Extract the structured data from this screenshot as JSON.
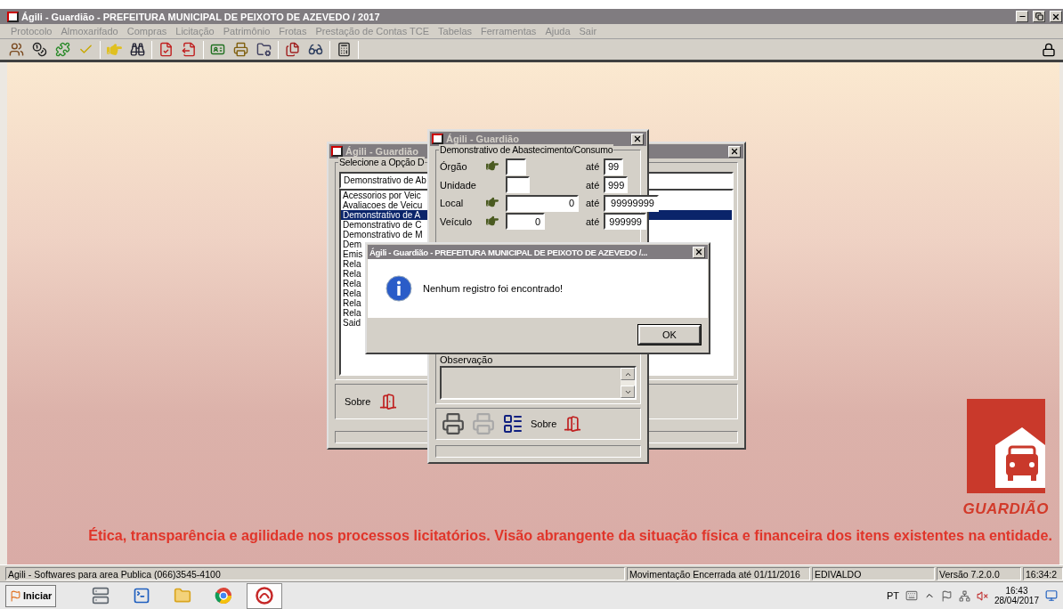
{
  "window": {
    "title": "Ágili - Guardião - PREFEITURA MUNICIPAL DE PEIXOTO DE AZEVEDO / 2017"
  },
  "menu": [
    "Protocolo",
    "Almoxarifado",
    "Compras",
    "Licitação",
    "Patrimônio",
    "Frotas",
    "Prestação de Contas TCE",
    "Tabelas",
    "Ferramentas",
    "Ajuda",
    "Sair"
  ],
  "selection_window": {
    "title": "Ágili - Guardião",
    "group_label": "Selecione a Opção D",
    "search_value": "Demonstrativo de Ab",
    "items": [
      {
        "label": "Acessorios por Veic",
        "selected": false
      },
      {
        "label": "Avaliacoes de Veicu",
        "selected": false
      },
      {
        "label": "Demonstrativo de A",
        "selected": true
      },
      {
        "label": "Demonstrativo de C",
        "selected": false
      },
      {
        "label": "Demonstrativo de M",
        "selected": false
      },
      {
        "label": "Dem",
        "selected": false
      },
      {
        "label": "Emis",
        "selected": false
      },
      {
        "label": "Rela",
        "selected": false
      },
      {
        "label": "Rela",
        "selected": false
      },
      {
        "label": "Rela",
        "selected": false
      },
      {
        "label": "Rela",
        "selected": false
      },
      {
        "label": "Rela",
        "selected": false
      },
      {
        "label": "Rela",
        "selected": false
      },
      {
        "label": "Said",
        "selected": false
      }
    ],
    "about_label": "Sobre"
  },
  "report_window": {
    "title": "Ágili - Guardião",
    "group_label": "Demonstrativo de Abastecimento/Consumo",
    "fields": [
      {
        "label": "Órgão",
        "has_picker": true,
        "to_label": "até",
        "to": "99"
      },
      {
        "label": "Unidade",
        "has_picker": false,
        "to_label": "até",
        "to": "999"
      },
      {
        "label": "Local",
        "has_picker": true,
        "from": "0",
        "to_label": "até",
        "to": "99999999"
      },
      {
        "label": "Veículo",
        "has_picker": true,
        "from": "0",
        "to_label": "até",
        "to": "999999"
      }
    ],
    "notes_label": "Observação",
    "about_label": "Sobre"
  },
  "message_box": {
    "title": "Ágili - Guardião - PREFEITURA MUNICIPAL DE PEIXOTO DE AZEVEDO /...",
    "message": "Nenhum registro foi encontrado!",
    "ok_label": "OK"
  },
  "branding": {
    "logo_text": "GUARDIÃO",
    "slogan": "Ética, transparência e agilidade nos processos licitatórios. Visão abrangente da situação física e financeira dos itens existentes na entidade."
  },
  "status_bar": [
    "Agili - Softwares para area Publica (066)3545-4100",
    "Movimentação Encerrada até 01/11/2016",
    "EDIVALDO",
    "Versão 7.2.0.0",
    "16:34:2"
  ],
  "taskbar": {
    "start_label": "Iniciar",
    "apps": [
      {
        "kind": "server",
        "selected": false
      },
      {
        "kind": "shell",
        "selected": false
      },
      {
        "kind": "folder",
        "selected": false
      },
      {
        "kind": "browser",
        "selected": false
      },
      {
        "kind": "agili",
        "selected": true
      }
    ],
    "language": "PT",
    "clock_time": "16:43",
    "clock_date": "28/04/2017"
  }
}
